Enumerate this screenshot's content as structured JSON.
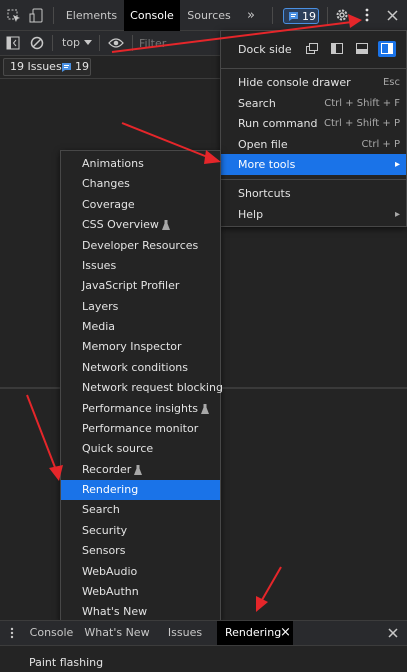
{
  "top_tabs": [
    {
      "label": "Elements"
    },
    {
      "label": "Console"
    },
    {
      "label": "Sources"
    }
  ],
  "top_overflow": "»",
  "issues_badge_count": "19",
  "toolbar": {
    "context": "top",
    "filter_placeholder": "Filter"
  },
  "issues_bar": {
    "label": "19 Issues:",
    "count": "19"
  },
  "main_menu": {
    "dock_side_label": "Dock side",
    "items": [
      {
        "label": "Hide console drawer",
        "shortcut": "Esc"
      },
      {
        "label": "Search",
        "shortcut": "Ctrl + Shift + F"
      },
      {
        "label": "Run command",
        "shortcut": "Ctrl + Shift + P"
      },
      {
        "label": "Open file",
        "shortcut": "Ctrl + P"
      },
      {
        "label": "More tools",
        "shortcut": "▸"
      },
      {
        "label": "Shortcuts",
        "shortcut": ""
      },
      {
        "label": "Help",
        "shortcut": "▸"
      }
    ]
  },
  "more_tools": [
    {
      "label": "Animations"
    },
    {
      "label": "Changes"
    },
    {
      "label": "Coverage"
    },
    {
      "label": "CSS Overview"
    },
    {
      "label": "Developer Resources"
    },
    {
      "label": "Issues"
    },
    {
      "label": "JavaScript Profiler"
    },
    {
      "label": "Layers"
    },
    {
      "label": "Media"
    },
    {
      "label": "Memory Inspector"
    },
    {
      "label": "Network conditions"
    },
    {
      "label": "Network request blocking"
    },
    {
      "label": "Performance insights"
    },
    {
      "label": "Performance monitor"
    },
    {
      "label": "Quick source"
    },
    {
      "label": "Recorder"
    },
    {
      "label": "Rendering"
    },
    {
      "label": "Search"
    },
    {
      "label": "Security"
    },
    {
      "label": "Sensors"
    },
    {
      "label": "WebAudio"
    },
    {
      "label": "WebAuthn"
    },
    {
      "label": "What's New"
    }
  ],
  "drawer_tabs": [
    {
      "label": "Console"
    },
    {
      "label": "What's New"
    },
    {
      "label": "Issues"
    },
    {
      "label": "Rendering"
    }
  ],
  "drawer_close": "×",
  "drawer_content": {
    "first_option": "Paint flashing"
  },
  "colors": {
    "accent": "#1a73e8",
    "annotation_arrow": "#e5262a"
  },
  "icons": [
    "inspect-icon",
    "device-toggle-icon",
    "messages-icon",
    "gear-icon",
    "kebab-menu-icon",
    "close-icon",
    "sidebar-icon",
    "clear-icon",
    "eye-icon",
    "chevron-down-icon",
    "dock-icons",
    "experimental-flask-icon"
  ]
}
